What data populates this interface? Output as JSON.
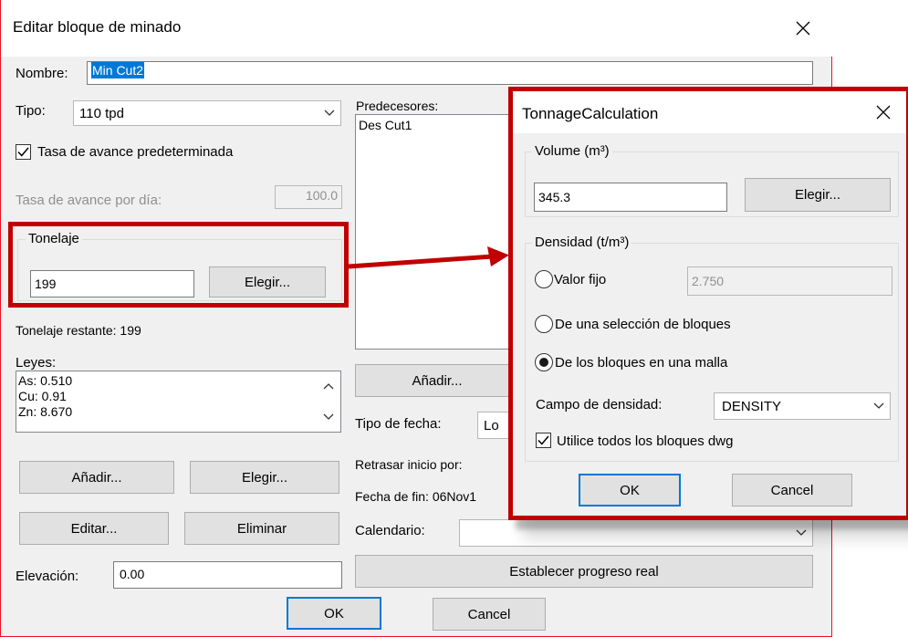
{
  "main": {
    "title": "Editar bloque de minado",
    "nombre_label": "Nombre:",
    "nombre_value": "Min Cut2",
    "tipo_label": "Tipo:",
    "tipo_value": "110 tpd",
    "tasa_default_label": "Tasa de avance predeterminada",
    "tasa_dia_label": "Tasa de avance por día:",
    "tasa_dia_value": "100.0",
    "tonelaje_group": "Tonelaje",
    "tonelaje_value": "199",
    "elegir_label": "Elegir...",
    "tonelaje_restante": "Tonelaje restante: 199",
    "leyes_label": "Leyes:",
    "leyes": [
      "As: 0.510",
      "Cu: 0.91",
      "Zn: 8.670"
    ],
    "anadir_label": "Añadir...",
    "elegir2_label": "Elegir...",
    "editar_label": "Editar...",
    "eliminar_label": "Eliminar",
    "elevacion_label": "Elevación:",
    "elevacion_value": "0.00",
    "predecesores_label": "Predecesores:",
    "predecesores": [
      "Des Cut1"
    ],
    "pred_anadir_label": "Añadir...",
    "tipo_fecha_label": "Tipo de fecha:",
    "tipo_fecha_value": "Lo",
    "retrasar_label": "Retrasar inicio por:",
    "fecha_fin_label": "Fecha de fin: 06Nov1",
    "calendario_label": "Calendario:",
    "calendario_value": "",
    "progreso_label": "Establecer progreso real",
    "ok_label": "OK",
    "cancel_label": "Cancel"
  },
  "popup": {
    "title": "TonnageCalculation",
    "volume_group": "Volume (m³)",
    "volume_value": "345.3",
    "elegir_label": "Elegir...",
    "densidad_group": "Densidad (t/m³)",
    "valor_fijo_label": "Valor fijo",
    "valor_fijo_value": "2.750",
    "seleccion_label": "De una selección de bloques",
    "malla_label": "De los bloques en una malla",
    "campo_label": "Campo de densidad:",
    "campo_value": "DENSITY",
    "dwg_label": "Utilice todos los bloques dwg",
    "ok_label": "OK",
    "cancel_label": "Cancel",
    "selected_option": "malla"
  },
  "colors": {
    "highlight": "#c00000",
    "accent": "#0078d7",
    "close_hover": "#e81123"
  }
}
